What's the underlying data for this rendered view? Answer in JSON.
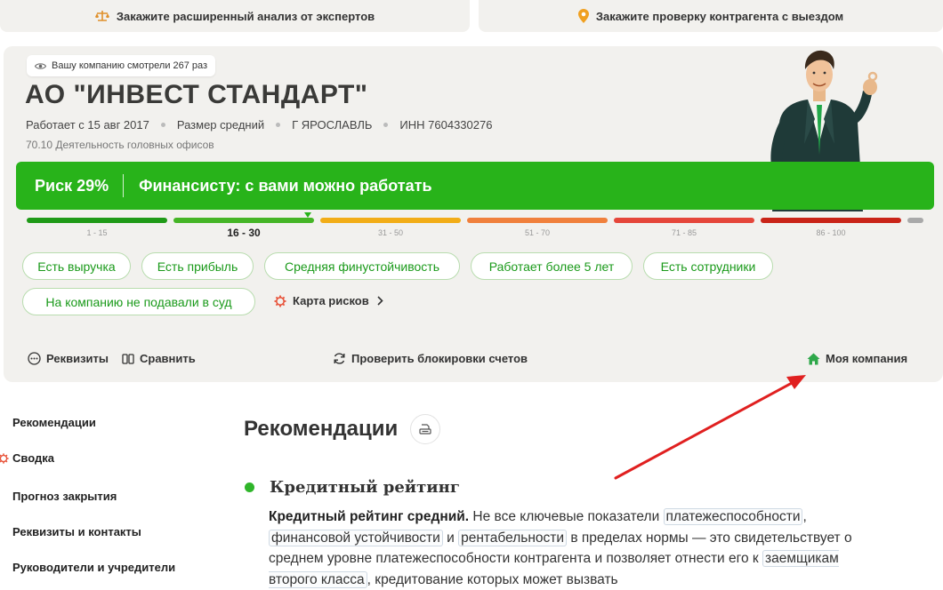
{
  "top_buttons": [
    {
      "label": "Закажите расширенный анализ от экспертов",
      "icon": "scales-icon"
    },
    {
      "label": "Закажите проверку контрагента с выездом",
      "icon": "location-pin-icon"
    }
  ],
  "company": {
    "views": "Вашу компанию смотрели 267 раз",
    "name": "АО \"ИНВЕСТ СТАНДАРТ\"",
    "since": "Работает с 15 авг 2017",
    "size": "Размер средний",
    "city": "Г ЯРОСЛАВЛЬ",
    "inn": "ИНН 7604330276",
    "okved": "70.10 Деятельность головных офисов"
  },
  "risk": {
    "percent_label": "Риск 29%",
    "verdict": "Финансисту: с вами можно работать",
    "value": 29,
    "scale": [
      {
        "label": "1 - 15",
        "color": "#1f9a17"
      },
      {
        "label": "16 - 30",
        "color": "#45b526",
        "active": true
      },
      {
        "label": "31 - 50",
        "color": "#f2ad17"
      },
      {
        "label": "51 - 70",
        "color": "#f0803c"
      },
      {
        "label": "71 - 85",
        "color": "#e5463a"
      },
      {
        "label": "86 - 100",
        "color": "#c92418"
      },
      {
        "label": "",
        "color": "#a9a9a9"
      }
    ]
  },
  "tags": [
    "Есть выручка",
    "Есть прибыль",
    "Средняя финустойчивость",
    "Работает более 5 лет",
    "Есть сотрудники",
    "На компанию не подавали в суд"
  ],
  "risk_map": {
    "label": "Карта рисков",
    "icon": "gear-icon"
  },
  "actions": {
    "details": "Реквизиты",
    "compare": "Сравнить",
    "check_blocks": "Проверить блокировки счетов",
    "my_company": "Моя компания"
  },
  "sidebar": {
    "items": [
      "Рекомендации",
      "Сводка",
      "Прогноз закрытия",
      "Реквизиты и контакты",
      "Руководители и учредители"
    ]
  },
  "main": {
    "title": "Рекомендации",
    "section_title": "Кредитный рейтинг",
    "para_bold": "Кредитный рейтинг средний.",
    "para_1": " Не все ключевые показатели ",
    "link_1": "платежеспособности",
    "para_2": ", ",
    "link_2": "финансовой устойчивости",
    "para_3": " и ",
    "link_3": "рентабельности",
    "para_4": " в пределах нормы — это свидетельствует о среднем уровне платежеспособности контрагента и позволяет отнести его к ",
    "link_4": "заемщикам второго класса",
    "para_5": ", кредитование которых может вызвать"
  },
  "colors": {
    "accent_green": "#28b31a",
    "card_bg": "#f2f1ee",
    "annotation_arrow": "#e02020"
  }
}
